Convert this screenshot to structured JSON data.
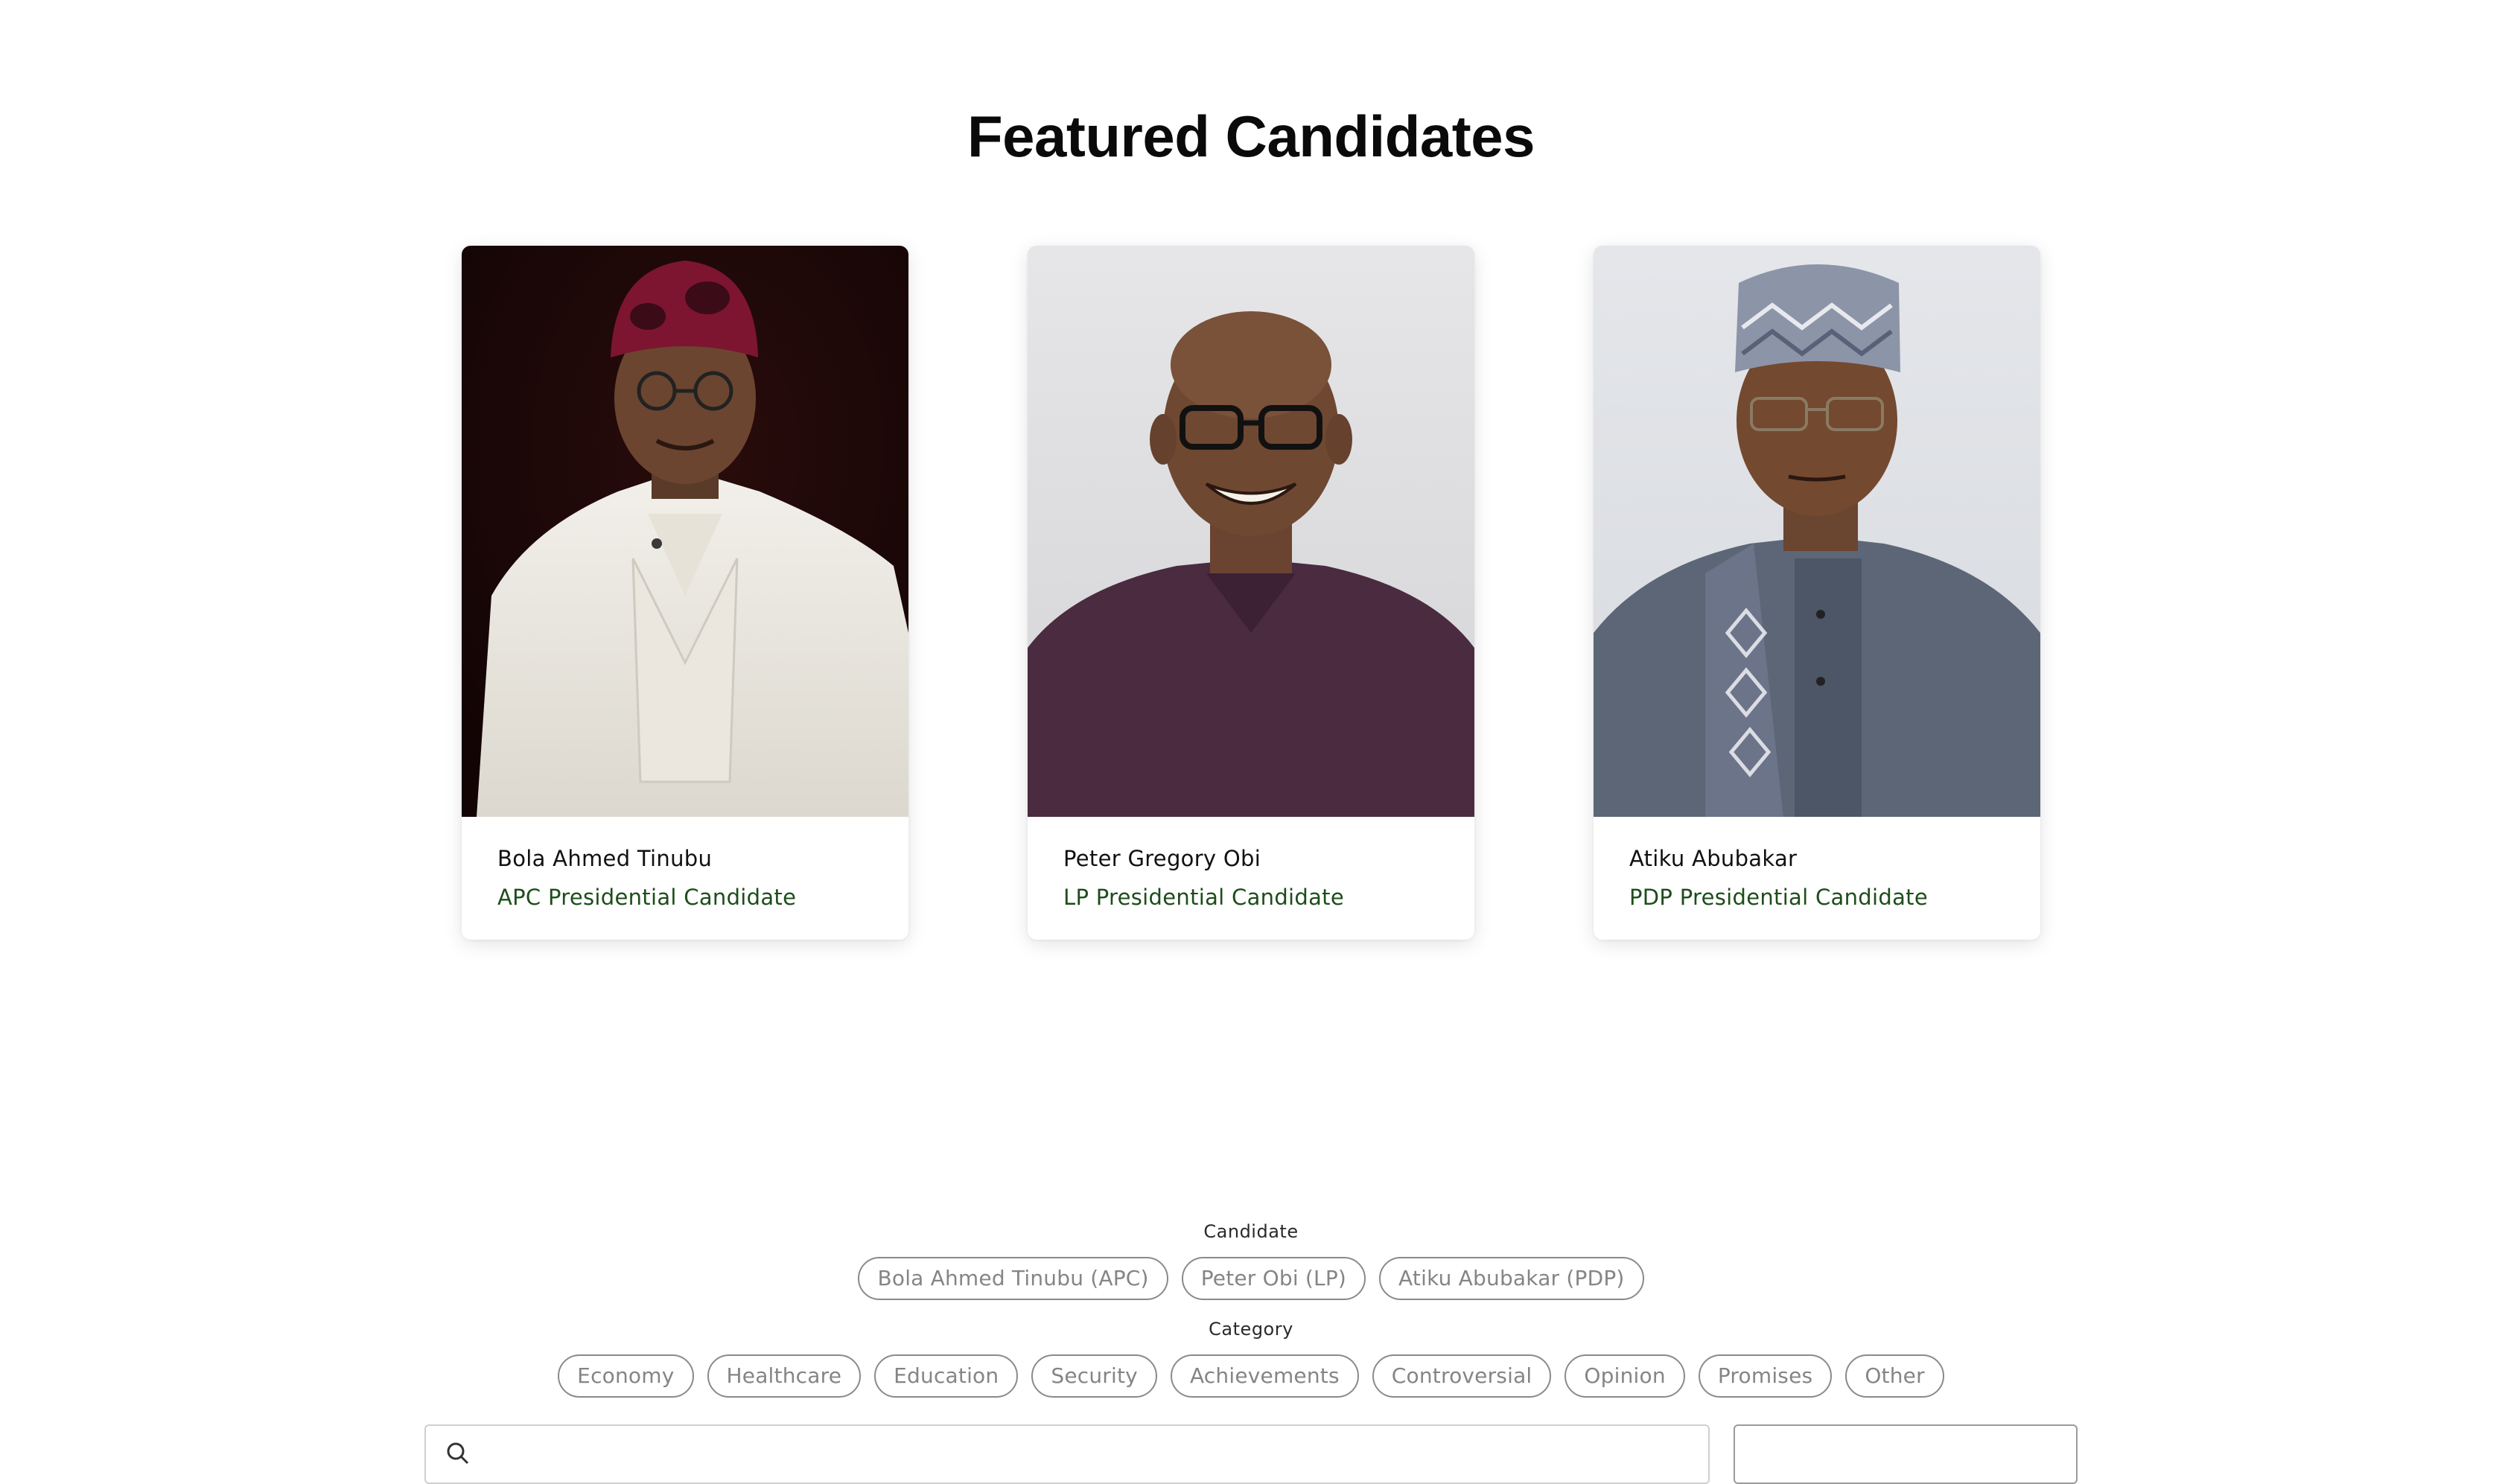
{
  "section": {
    "title": "Featured Candidates"
  },
  "candidates": [
    {
      "name": "Bola Ahmed Tinubu",
      "party_label": "APC Presidential Candidate",
      "photo_alt": "Bola Ahmed Tinubu"
    },
    {
      "name": "Peter Gregory Obi",
      "party_label": "LP Presidential Candidate",
      "photo_alt": "Peter Gregory Obi"
    },
    {
      "name": "Atiku Abubakar",
      "party_label": "PDP Presidential Candidate",
      "photo_alt": "Atiku Abubakar"
    }
  ],
  "filters": {
    "candidate_label": "Candidate",
    "candidate_options": [
      "Bola Ahmed Tinubu (APC)",
      "Peter Obi (LP)",
      "Atiku Abubakar (PDP)"
    ],
    "category_label": "Category",
    "category_options": [
      "Economy",
      "Healthcare",
      "Education",
      "Security",
      "Achievements",
      "Controversial",
      "Opinion",
      "Promises",
      "Other"
    ]
  },
  "colors": {
    "party_text": "#1d4d1a",
    "chip_border": "#8a8a8a",
    "chip_text": "#858585"
  },
  "icons": {
    "search": "search-icon"
  }
}
